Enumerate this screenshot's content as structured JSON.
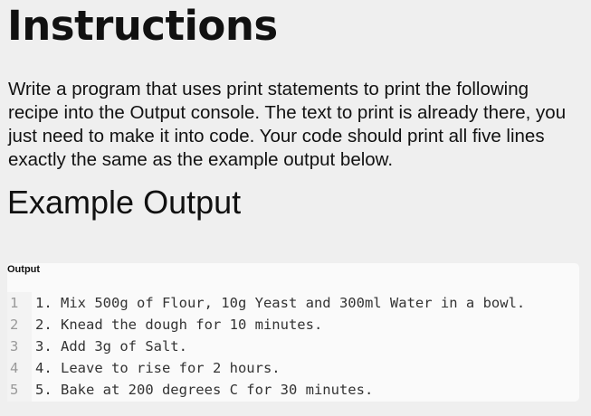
{
  "title": "Instructions",
  "description": "Write a program that uses print statements to print the following recipe into the Output console. The text to print is already there, you just need to make it into code. Your code should print all five lines exactly the same as the example output below.",
  "example_heading": "Example Output",
  "output_panel": {
    "title": "Output",
    "lines": [
      {
        "num": "1",
        "text": "1. Mix 500g of Flour, 10g Yeast and 300ml Water in a bowl."
      },
      {
        "num": "2",
        "text": "2. Knead the dough for 10 minutes."
      },
      {
        "num": "3",
        "text": "3. Add 3g of Salt."
      },
      {
        "num": "4",
        "text": "4. Leave to rise for 2 hours."
      },
      {
        "num": "5",
        "text": "5. Bake at 200 degrees C for 30 minutes."
      }
    ]
  }
}
